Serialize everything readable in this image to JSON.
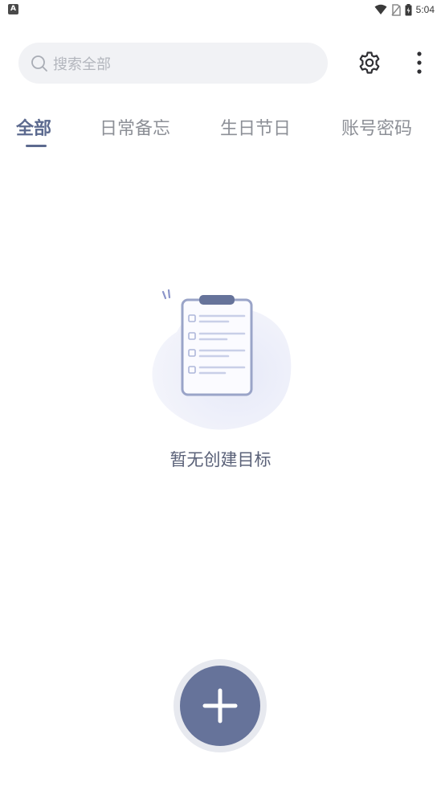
{
  "status_bar": {
    "app_icon_letter": "A",
    "time": "5:04"
  },
  "search": {
    "placeholder": "搜索全部"
  },
  "tabs": [
    {
      "label": "全部",
      "active": true
    },
    {
      "label": "日常备忘",
      "active": false
    },
    {
      "label": "生日节日",
      "active": false
    },
    {
      "label": "账号密码",
      "active": false
    }
  ],
  "empty_state": {
    "message": "暂无创建目标"
  },
  "colors": {
    "accent": "#5c6a8f",
    "fab": "#66739a",
    "search_bg": "#f1f2f5",
    "tab_inactive": "#8d9097"
  },
  "icons": {
    "search": "search-icon",
    "settings": "gear-icon",
    "more": "more-vertical-icon",
    "add": "plus-icon",
    "illustration": "clipboard-checklist-icon"
  }
}
